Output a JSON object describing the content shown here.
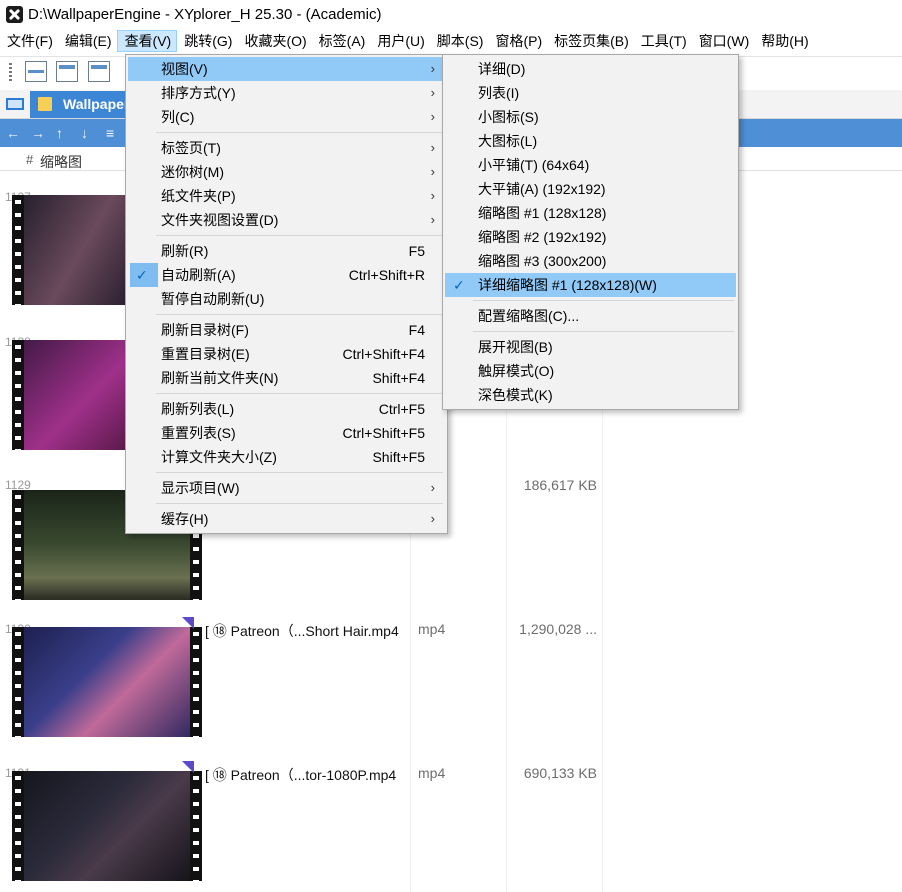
{
  "window": {
    "title": "D:\\WallpaperEngine - XYplorer_H 25.30 - (Academic)"
  },
  "menubar": [
    "文件(F)",
    "编辑(E)",
    "查看(V)",
    "跳转(G)",
    "收藏夹(O)",
    "标签(A)",
    "用户(U)",
    "脚本(S)",
    "窗格(P)",
    "标签页集(B)",
    "工具(T)",
    "窗口(W)",
    "帮助(H)"
  ],
  "tab": {
    "label": "Wallpaper"
  },
  "list": {
    "header_index": "#",
    "header_thumb": "缩略图",
    "rows": [
      {
        "index": "1127",
        "name": "",
        "type": "",
        "size": ""
      },
      {
        "index": "1128",
        "name": "",
        "type": "",
        "size": ""
      },
      {
        "index": "1129",
        "name": "",
        "type": "",
        "size": "186,617 KB"
      },
      {
        "index": "1130",
        "name": "[ ⑱ Patreon（...Short Hair.mp4",
        "type": "mp4",
        "size": "1,290,028 ..."
      },
      {
        "index": "1131",
        "name": "[ ⑱ Patreon（...tor-1080P.mp4",
        "type": "mp4",
        "size": "690,133 KB"
      }
    ]
  },
  "view_menu": {
    "items": [
      {
        "label": "视图(V)",
        "shortcut": "",
        "submenu": true
      },
      {
        "label": "排序方式(Y)",
        "shortcut": "",
        "submenu": true
      },
      {
        "label": "列(C)",
        "shortcut": "",
        "submenu": true
      },
      {
        "label": "标签页(T)",
        "shortcut": "",
        "submenu": true
      },
      {
        "label": "迷你树(M)",
        "shortcut": "",
        "submenu": true
      },
      {
        "label": "纸文件夹(P)",
        "shortcut": "",
        "submenu": true
      },
      {
        "label": "文件夹视图设置(D)",
        "shortcut": "",
        "submenu": true
      },
      {
        "label": "刷新(R)",
        "shortcut": "F5"
      },
      {
        "label": "自动刷新(A)",
        "shortcut": "Ctrl+Shift+R",
        "checked": true
      },
      {
        "label": "暂停自动刷新(U)",
        "shortcut": ""
      },
      {
        "label": "刷新目录树(F)",
        "shortcut": "F4"
      },
      {
        "label": "重置目录树(E)",
        "shortcut": "Ctrl+Shift+F4"
      },
      {
        "label": "刷新当前文件夹(N)",
        "shortcut": "Shift+F4"
      },
      {
        "label": "刷新列表(L)",
        "shortcut": "Ctrl+F5"
      },
      {
        "label": "重置列表(S)",
        "shortcut": "Ctrl+Shift+F5"
      },
      {
        "label": "计算文件夹大小(Z)",
        "shortcut": "Shift+F5"
      },
      {
        "label": "显示项目(W)",
        "shortcut": "",
        "submenu": true
      },
      {
        "label": "缓存(H)",
        "shortcut": "",
        "submenu": true
      }
    ]
  },
  "view_submenu": {
    "items": [
      {
        "label": "详细(D)"
      },
      {
        "label": "列表(I)"
      },
      {
        "label": "小图标(S)"
      },
      {
        "label": "大图标(L)"
      },
      {
        "label": "小平铺(T) (64x64)"
      },
      {
        "label": "大平铺(A) (192x192)"
      },
      {
        "label": "缩略图 #1 (128x128)"
      },
      {
        "label": "缩略图 #2 (192x192)"
      },
      {
        "label": "缩略图 #3 (300x200)"
      },
      {
        "label": "详细缩略图 #1 (128x128)(W)",
        "checked": true
      },
      {
        "label": "配置缩略图(C)..."
      },
      {
        "label": "展开视图(B)"
      },
      {
        "label": "触屏模式(O)"
      },
      {
        "label": "深色模式(K)"
      }
    ]
  },
  "icons": {
    "check": "✓",
    "arrow": "›"
  },
  "colors": {
    "accent": "#3d86d6",
    "nav": "#4f8fd6",
    "menu_highlight": "#91c9f7",
    "menu_bg": "#f2f2f2"
  }
}
